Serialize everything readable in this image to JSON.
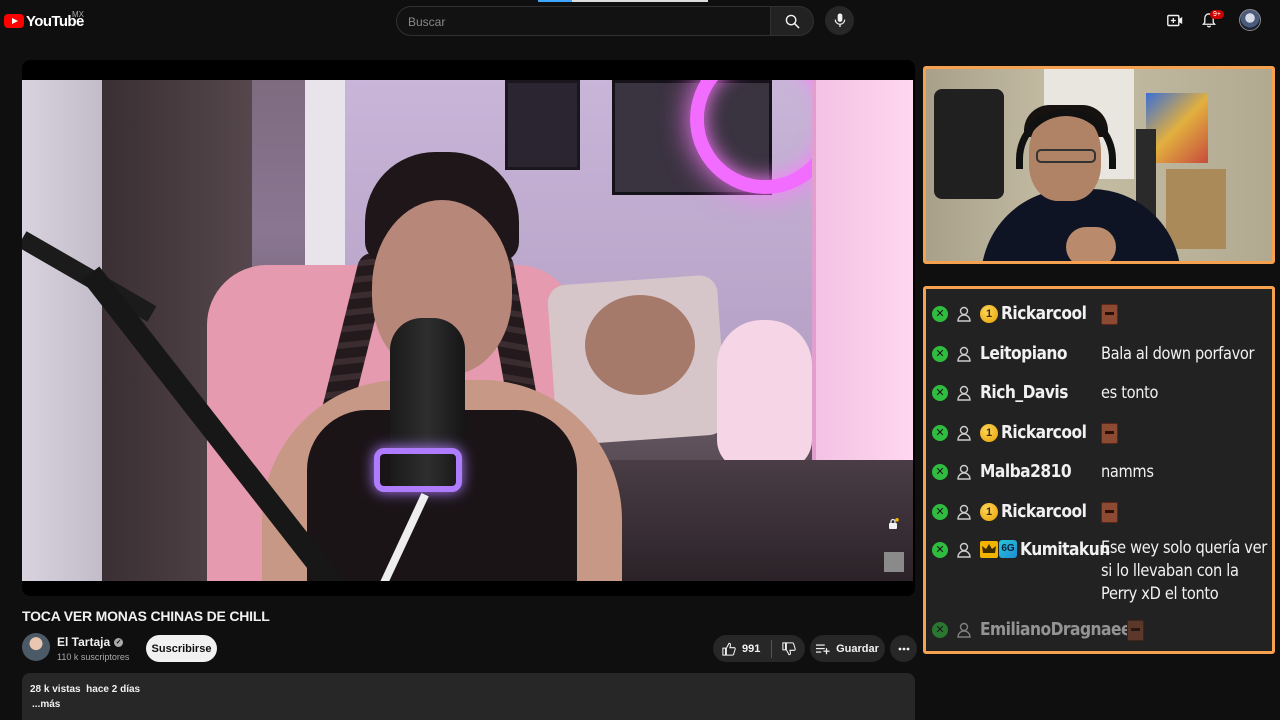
{
  "masthead": {
    "logo_text": "YouTube",
    "country_code": "MX",
    "search_placeholder": "Buscar",
    "notification_count": "9+"
  },
  "video": {
    "title": "TOCA VER MONAS CHINAS DE CHILL",
    "channel_name": "El Tartaja",
    "subscribers": "110 k suscriptores",
    "subscribe_label": "Suscribirse",
    "likes": "991",
    "save_label": "Guardar",
    "views": "28 k vistas",
    "uploaded": "hace 2 días",
    "more_label": "...más"
  },
  "chat": {
    "messages": [
      {
        "username": "Rickarcool",
        "badges": [
          "mod",
          "user",
          "coin"
        ],
        "coin_number": "1",
        "text": "",
        "emote": "pixel-face-emote"
      },
      {
        "username": "Leitopiano",
        "badges": [
          "mod",
          "user"
        ],
        "text": "Bala al down porfavor"
      },
      {
        "username": "Rich_Davis",
        "badges": [
          "mod",
          "user"
        ],
        "text": "es tonto"
      },
      {
        "username": "Rickarcool",
        "badges": [
          "mod",
          "user",
          "coin"
        ],
        "coin_number": "1",
        "text": "",
        "emote": "pixel-face-emote"
      },
      {
        "username": "Malba2810",
        "badges": [
          "mod",
          "user"
        ],
        "text": "namms"
      },
      {
        "username": "Rickarcool",
        "badges": [
          "mod",
          "user",
          "coin"
        ],
        "coin_number": "1",
        "text": "",
        "emote": "pixel-face-emote"
      },
      {
        "username": "Kumitakun",
        "badges": [
          "mod",
          "user",
          "crown",
          "sub"
        ],
        "sub_text": "6G",
        "text_lines": [
          "Ese wey solo quería ver",
          "si lo llevaban con la",
          "Perry xD el tonto"
        ]
      },
      {
        "username": "EmilianoDragnaeel",
        "badges": [
          "mod",
          "user"
        ],
        "text": "",
        "emote": "pixel-face-emote"
      }
    ]
  },
  "colors": {
    "overlay_border": "#f5a14f",
    "mod_badge": "#2fbd3f",
    "brand_red": "#ff0000",
    "background": "#0f0f0f"
  }
}
